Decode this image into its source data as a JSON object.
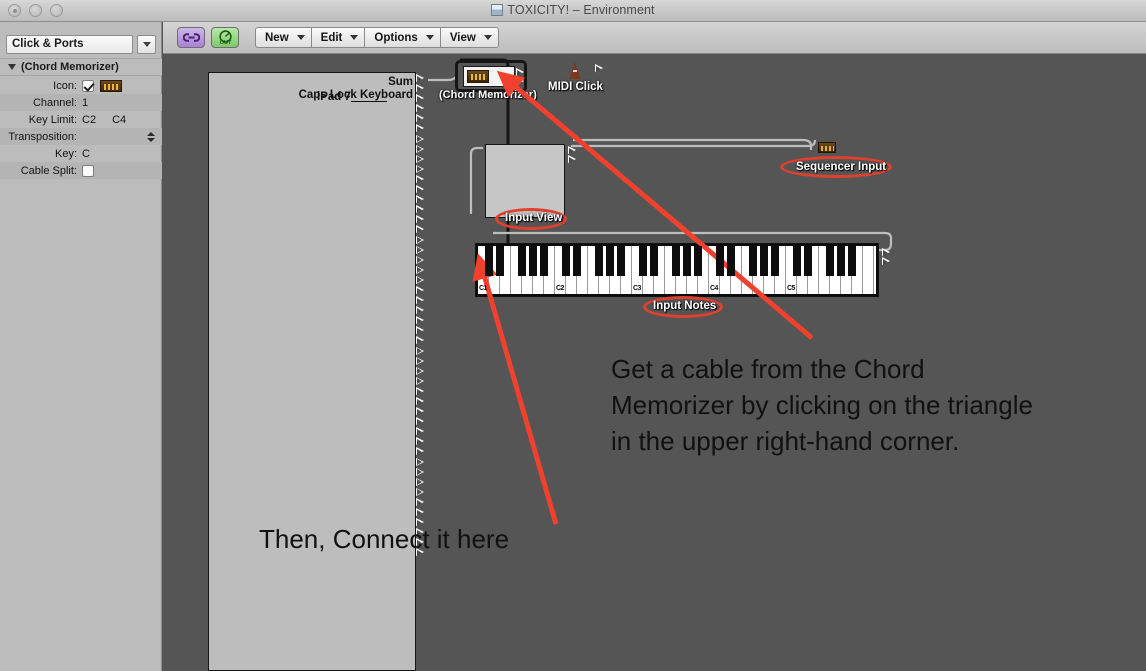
{
  "window": {
    "title": "TOXICITY! – Environment",
    "title_icon": "environment-window-icon",
    "controls": [
      "close-button",
      "minimize-button",
      "zoom-button"
    ]
  },
  "inspector": {
    "layer_select": "Click & Ports",
    "layer_popup_icon": "chevron-down-icon",
    "section_title": "(Chord Memorizer)",
    "disclosure_icon": "triangle-down-icon",
    "fields": [
      {
        "label": "Icon:",
        "type": "checkbox-and-icon",
        "checked": true,
        "icon": "chord-memorizer-icon"
      },
      {
        "label": "Channel:",
        "type": "text",
        "value": "1"
      },
      {
        "label": "Key Limit:",
        "type": "range",
        "value_low": "C2",
        "value_high": "C4"
      },
      {
        "label": "Transposition:",
        "type": "stepper",
        "value": ""
      },
      {
        "label": "Key:",
        "type": "text",
        "value": "C"
      },
      {
        "label": "Cable Split:",
        "type": "checkbox",
        "checked": false
      }
    ]
  },
  "toolbar": {
    "buttons": [
      {
        "name": "cable-link-button",
        "icon": "link-icon",
        "color": "#a97fd4"
      },
      {
        "name": "midi-out-button",
        "icon": "out-meter-icon",
        "color": "#7ec96a"
      }
    ],
    "menus": [
      {
        "label": "New",
        "icon": "chevron-down-icon"
      },
      {
        "label": "Edit",
        "icon": "chevron-down-icon"
      },
      {
        "label": "Options",
        "icon": "chevron-down-icon"
      },
      {
        "label": "View",
        "icon": "chevron-down-icon"
      }
    ]
  },
  "canvas": {
    "objects": {
      "physical_input": {
        "name": "physical-input-object",
        "label_top": "Sum",
        "label_bottom": "Caps Lock Keyboard",
        "side_label": "iPad 7",
        "port_count": 48
      },
      "chord_memorizer": {
        "name": "chord-memorizer-object",
        "label": "(Chord Memorizer)",
        "selected": true,
        "icon": "chord-memorizer-icon"
      },
      "midi_click": {
        "name": "midi-click-object",
        "label": "MIDI Click",
        "icon": "metronome-icon"
      },
      "input_view": {
        "name": "input-view-object",
        "label": "Input View"
      },
      "sequencer_input": {
        "name": "sequencer-input-object",
        "label": "Sequencer Input",
        "icon": "instrument-icon"
      },
      "input_notes": {
        "name": "input-notes-keyboard-object",
        "label": "Input Notes",
        "octave_labels": [
          "C1",
          "C2",
          "C3",
          "C4",
          "C5"
        ]
      }
    }
  },
  "annotations": {
    "arrow_color": "#f0402e",
    "oval_color": "#e0402e",
    "callout_1": {
      "name": "callout-chord-memorizer-cable",
      "lines": [
        "Get a cable from the Chord",
        "Memorizer by clicking on the triangle",
        "in the upper right-hand corner."
      ]
    },
    "callout_2": {
      "name": "callout-connect-here",
      "text": "Then, Connect it here"
    },
    "highlighted_labels": [
      "Input View",
      "Sequencer Input",
      "Input Notes"
    ]
  }
}
